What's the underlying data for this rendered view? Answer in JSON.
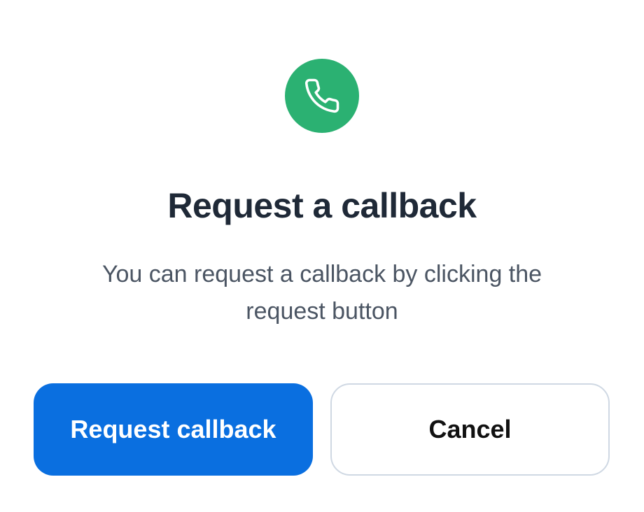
{
  "icon": {
    "name": "phone-icon",
    "background": "#2bb172"
  },
  "title": "Request a callback",
  "description": "You can request a callback by clicking the request button",
  "actions": {
    "primary_label": "Request callback",
    "secondary_label": "Cancel"
  },
  "colors": {
    "primary": "#0a6fe0",
    "title": "#1f2937",
    "body_text": "#4b5563",
    "secondary_border": "#cfd8e3"
  }
}
